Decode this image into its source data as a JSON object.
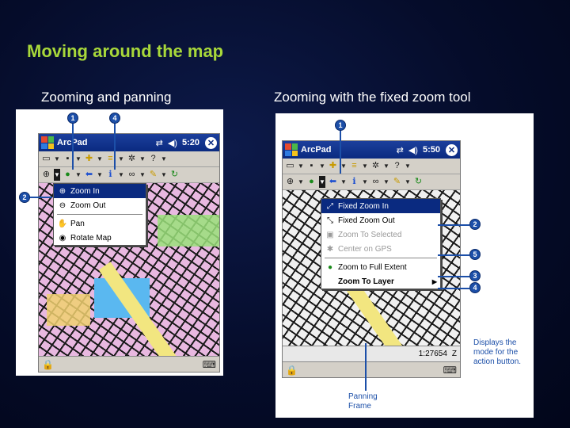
{
  "slide": {
    "title": "Moving around the map",
    "left_subtitle": "Zooming and panning",
    "right_subtitle": "Zooming with the fixed zoom tool"
  },
  "left_device": {
    "app_name": "ArcPad",
    "time": "5:20",
    "menu_items": [
      {
        "label": "Zoom In",
        "icon": "zoom-in-icon"
      },
      {
        "label": "Zoom Out",
        "icon": "zoom-out-icon"
      },
      {
        "label": "Pan",
        "icon": "hand-icon"
      },
      {
        "label": "Rotate Map",
        "icon": "rotate-icon"
      }
    ],
    "callouts": [
      "1",
      "4",
      "2"
    ]
  },
  "right_device": {
    "app_name": "ArcPad",
    "time": "5:50",
    "menu_items": [
      {
        "label": "Fixed Zoom In",
        "state": "selected"
      },
      {
        "label": "Fixed Zoom Out",
        "state": "normal"
      },
      {
        "label": "Zoom To Selected",
        "state": "disabled"
      },
      {
        "label": "Center on GPS",
        "state": "disabled"
      },
      {
        "label": "Zoom to Full Extent",
        "state": "normal"
      },
      {
        "label": "Zoom To Layer",
        "state": "bold"
      }
    ],
    "scale": "1:27654",
    "scale_suffix": "Z",
    "callouts": [
      "1",
      "2",
      "5",
      "3",
      "4"
    ],
    "note_action": "Displays the mode for the action button.",
    "note_panning": "Panning Frame"
  },
  "colors": {
    "title_green": "#a8d83a",
    "accent_blue": "#1c4fa8",
    "titlebar_blue": "#0a2a80"
  }
}
